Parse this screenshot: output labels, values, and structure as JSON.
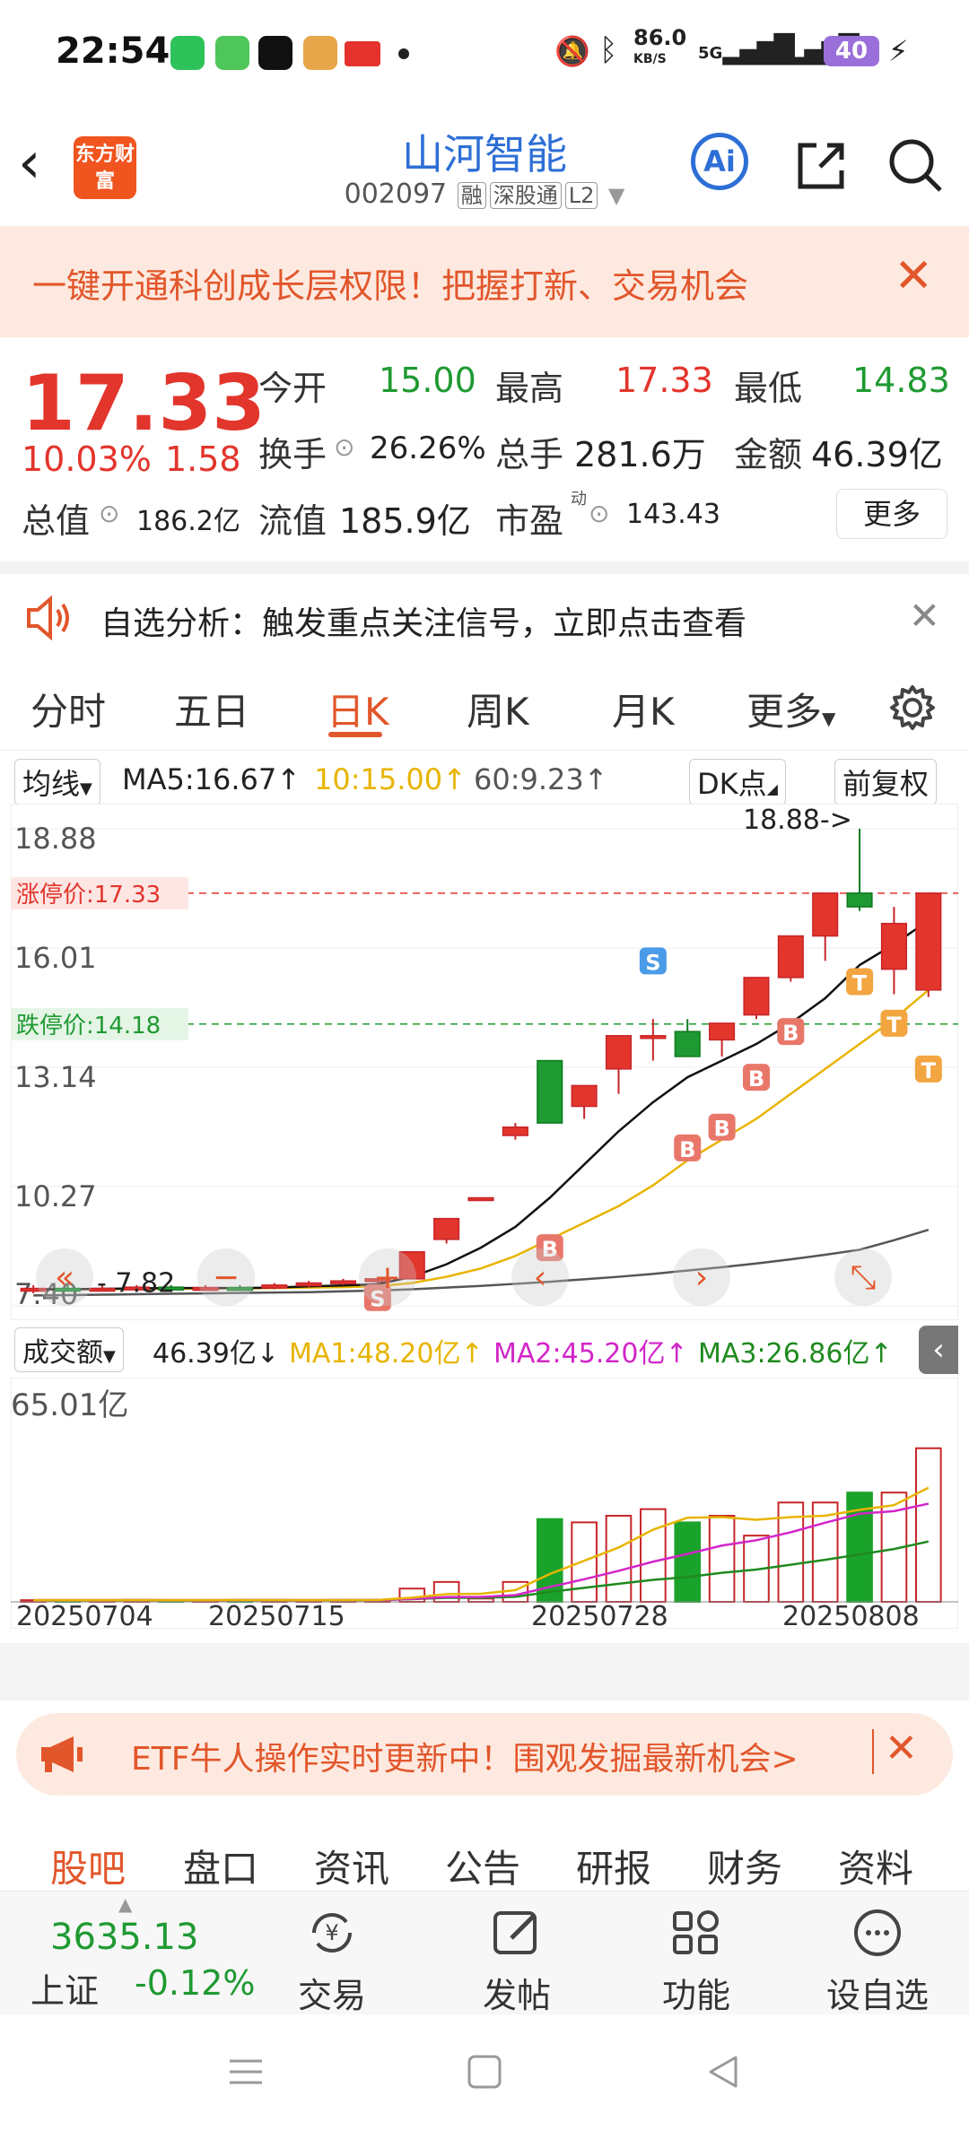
{
  "status": {
    "time": "22:54",
    "speed": "86.0",
    "speed_unit": "KB/S",
    "net1": "5G",
    "net2": "5G",
    "battery": "40"
  },
  "header": {
    "logo": "东方财富",
    "title": "山河智能",
    "code": "002097",
    "tag1": "融",
    "tag2": "深股通",
    "tag3": "L2",
    "ai": "Ai"
  },
  "banner1": {
    "text": "一键开通科创成长层权限！把握打新、交易机会",
    "close": "✕"
  },
  "quote": {
    "price": "17.33",
    "change_pct": "10.03%",
    "change": "1.58",
    "open_label": "今开",
    "open": "15.00",
    "high_label": "最高",
    "high": "17.33",
    "low_label": "最低",
    "low": "14.83",
    "turnover_label": "换手",
    "turnover": "26.26%",
    "volume_label": "总手",
    "volume": "281.6万",
    "amount_label": "金额",
    "amount": "46.39亿",
    "mcap_label": "总值",
    "mcap": "186.2亿",
    "float_label": "流值",
    "float": "185.9亿",
    "pe_label": "市盈",
    "pe_sup": "动",
    "pe": "143.43",
    "more": "更多"
  },
  "alert": {
    "text": "自选分析：触发重点关注信号，立即点击查看",
    "close": "✕"
  },
  "tabs": [
    "分时",
    "五日",
    "日K",
    "周K",
    "月K",
    "更多"
  ],
  "active_tab": "日K",
  "chart_header": {
    "ma_select": "均线",
    "ma5": "MA5:16.67↑",
    "ma10": "10:15.00↑",
    "ma60": "60:9.23↑",
    "dk": "DK点",
    "adjust": "前复权"
  },
  "chart_labels": {
    "p1": "18.88",
    "p2": "16.01",
    "p3": "13.14",
    "p4": "10.27",
    "p5": "7.40",
    "limit_up": "涨停价:17.33",
    "limit_down": "跌停价:14.18",
    "max_mark": "18.88->",
    "min_mark": "7.82"
  },
  "vol_header": {
    "select": "成交额",
    "val": "46.39亿↓",
    "ma1": "MA1:48.20亿↑",
    "ma2": "MA2:45.20亿↑",
    "ma3": "MA3:26.86亿↑",
    "top": "65.01亿"
  },
  "dates": [
    "20250704",
    "20250715",
    "20250728",
    "20250808"
  ],
  "chart_data": {
    "type": "candlestick",
    "ylim": [
      7.4,
      18.88
    ],
    "candles": [
      {
        "o": 7.8,
        "h": 7.9,
        "l": 7.7,
        "c": 7.82
      },
      {
        "o": 7.82,
        "h": 7.9,
        "l": 7.75,
        "c": 7.8
      },
      {
        "o": 7.8,
        "h": 7.9,
        "l": 7.75,
        "c": 7.82
      },
      {
        "o": 7.82,
        "h": 7.9,
        "l": 7.78,
        "c": 7.85
      },
      {
        "o": 7.85,
        "h": 7.9,
        "l": 7.8,
        "c": 7.82
      },
      {
        "o": 7.82,
        "h": 7.9,
        "l": 7.78,
        "c": 7.84
      },
      {
        "o": 7.84,
        "h": 7.9,
        "l": 7.8,
        "c": 7.83
      },
      {
        "o": 7.83,
        "h": 7.95,
        "l": 7.8,
        "c": 7.9
      },
      {
        "o": 7.9,
        "h": 8.0,
        "l": 7.85,
        "c": 7.95
      },
      {
        "o": 7.95,
        "h": 8.05,
        "l": 7.9,
        "c": 8.0
      },
      {
        "o": 8.0,
        "h": 8.1,
        "l": 7.95,
        "c": 8.05
      },
      {
        "o": 8.05,
        "h": 8.7,
        "l": 8.05,
        "c": 8.7
      },
      {
        "o": 9.0,
        "h": 9.5,
        "l": 8.9,
        "c": 9.5
      },
      {
        "o": 10.0,
        "h": 10.0,
        "l": 10.0,
        "c": 10.0
      },
      {
        "o": 11.5,
        "h": 11.8,
        "l": 11.4,
        "c": 11.7
      },
      {
        "o": 13.3,
        "h": 13.3,
        "l": 11.8,
        "c": 11.8
      },
      {
        "o": 12.2,
        "h": 12.7,
        "l": 11.9,
        "c": 12.7
      },
      {
        "o": 13.1,
        "h": 13.3,
        "l": 12.5,
        "c": 13.9
      },
      {
        "o": 13.9,
        "h": 14.3,
        "l": 13.3,
        "c": 13.9
      },
      {
        "o": 14.0,
        "h": 14.3,
        "l": 13.5,
        "c": 13.4
      },
      {
        "o": 13.8,
        "h": 14.2,
        "l": 13.4,
        "c": 14.2
      },
      {
        "o": 14.4,
        "h": 15.3,
        "l": 14.3,
        "c": 15.3
      },
      {
        "o": 15.3,
        "h": 16.3,
        "l": 15.2,
        "c": 16.3
      },
      {
        "o": 16.3,
        "h": 17.33,
        "l": 15.7,
        "c": 17.33
      },
      {
        "o": 17.33,
        "h": 18.88,
        "l": 16.9,
        "c": 17.0
      },
      {
        "o": 15.5,
        "h": 17.0,
        "l": 14.9,
        "c": 16.6
      },
      {
        "o": 15.0,
        "h": 17.33,
        "l": 14.83,
        "c": 17.33
      }
    ],
    "ma5": [
      7.8,
      7.8,
      7.81,
      7.82,
      7.83,
      7.83,
      7.83,
      7.84,
      7.87,
      7.89,
      7.92,
      8.1,
      8.4,
      8.8,
      9.3,
      10.0,
      10.8,
      11.6,
      12.3,
      12.9,
      13.3,
      13.7,
      14.2,
      14.8,
      15.6,
      16.1,
      16.67
    ],
    "ma10": [
      7.8,
      7.8,
      7.8,
      7.81,
      7.81,
      7.82,
      7.82,
      7.83,
      7.84,
      7.85,
      7.87,
      7.95,
      8.1,
      8.3,
      8.6,
      9.0,
      9.4,
      9.8,
      10.3,
      10.9,
      11.4,
      11.9,
      12.5,
      13.1,
      13.7,
      14.3,
      15.0
    ],
    "ma60": [
      7.65,
      7.66,
      7.67,
      7.68,
      7.69,
      7.7,
      7.71,
      7.72,
      7.73,
      7.75,
      7.77,
      7.8,
      7.84,
      7.88,
      7.93,
      7.98,
      8.04,
      8.1,
      8.17,
      8.25,
      8.33,
      8.42,
      8.52,
      8.63,
      8.75,
      8.98,
      9.23
    ],
    "volume": [
      0.5,
      0.5,
      0.5,
      0.6,
      0.5,
      0.5,
      0.6,
      0.5,
      0.5,
      0.6,
      0.6,
      4,
      6,
      1,
      6,
      25,
      24,
      26,
      28,
      24,
      26,
      20,
      30,
      30,
      33,
      33,
      46.39
    ],
    "volume_max": 65.01
  }
}
